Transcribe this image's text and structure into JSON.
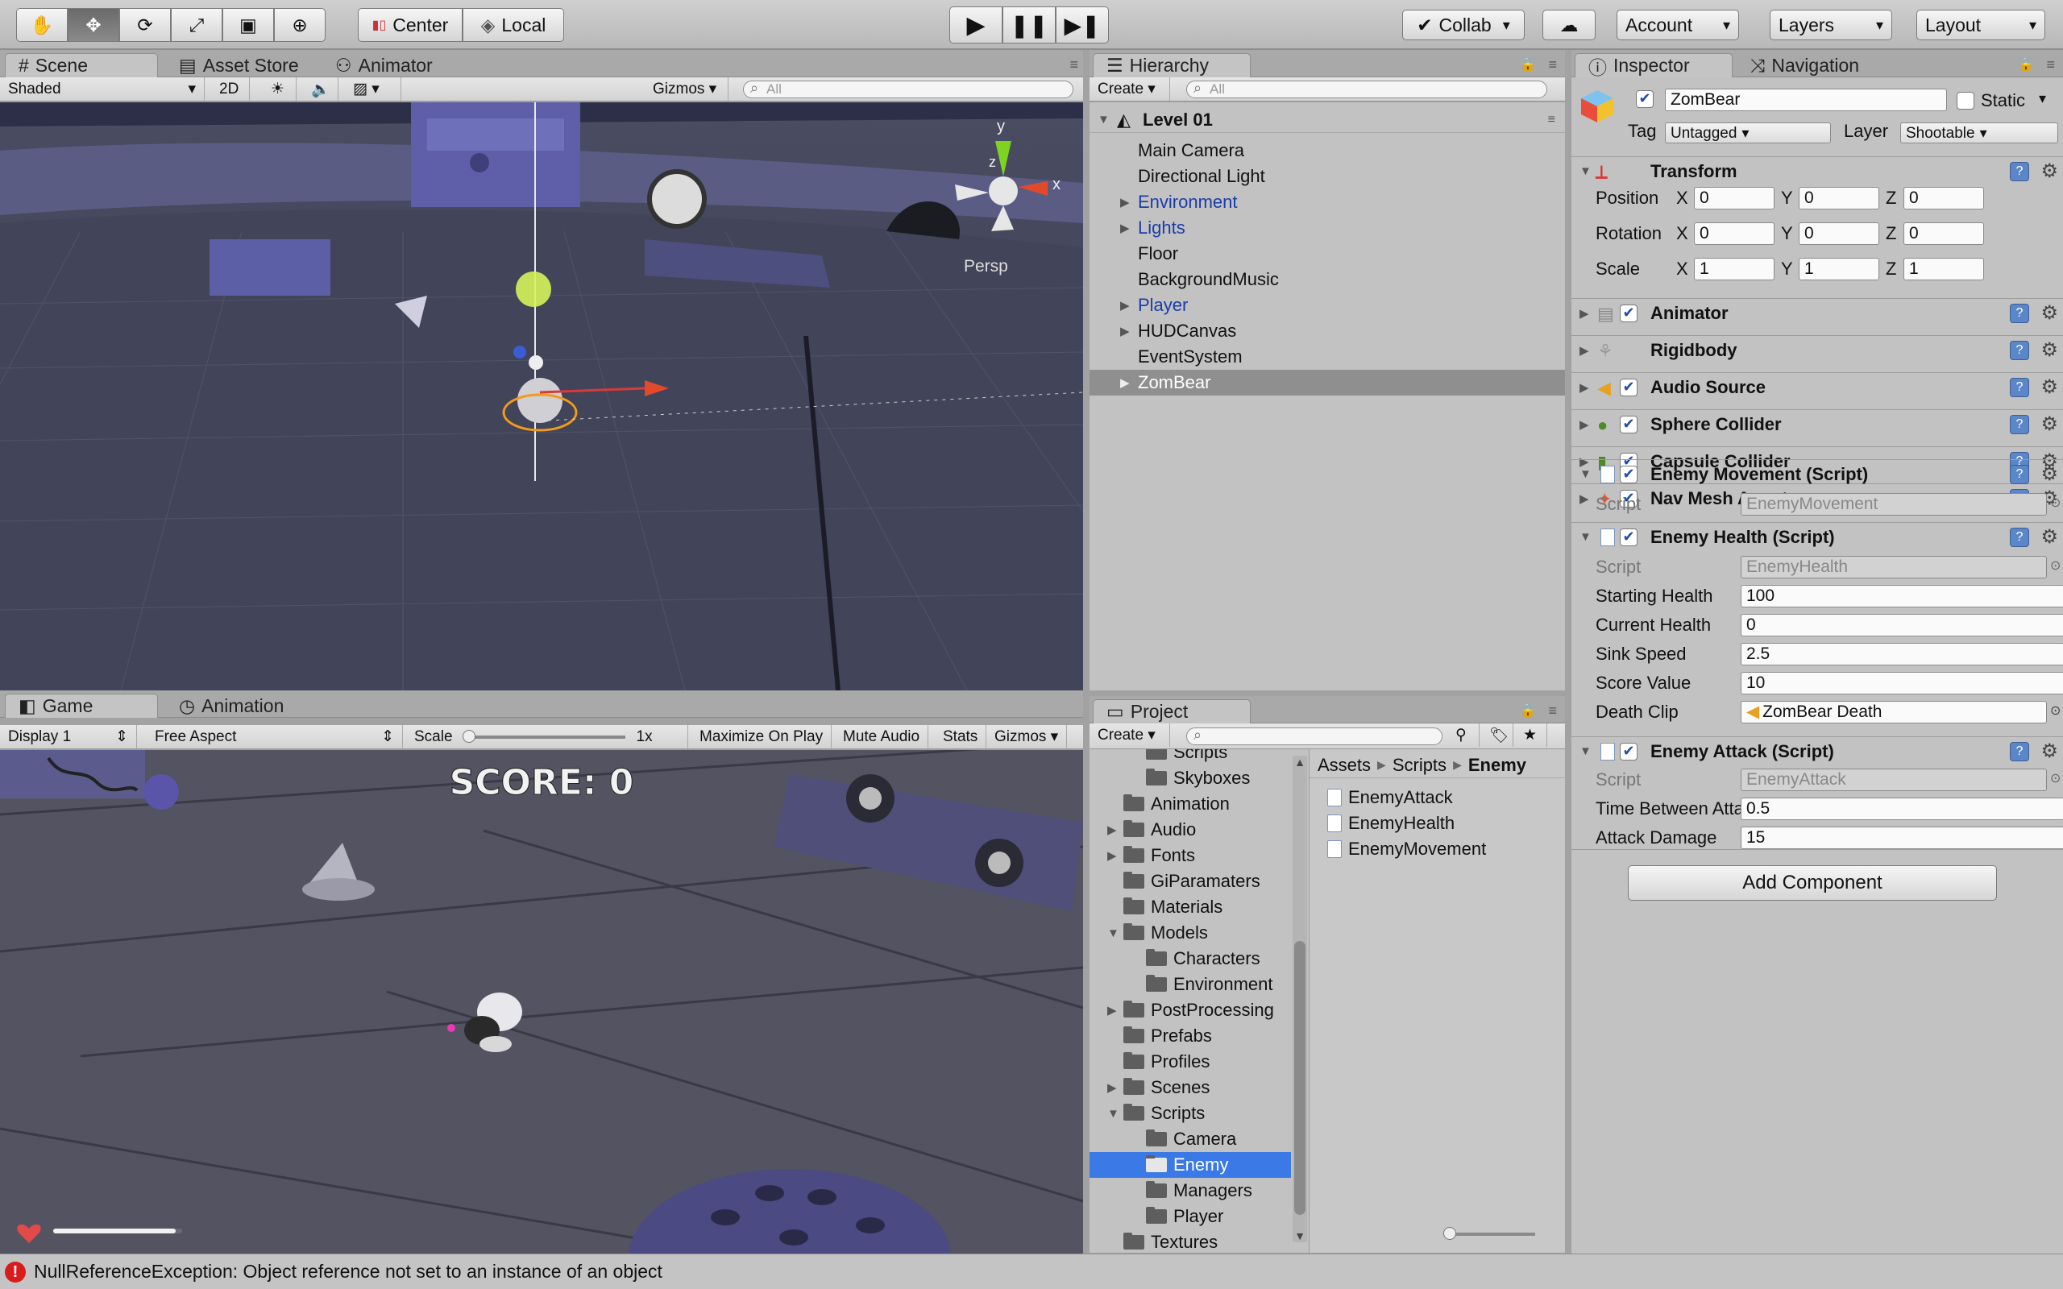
{
  "toolbar": {
    "transform_tools": [
      "hand-tool",
      "move-tool",
      "rotate-tool",
      "scale-tool",
      "rect-tool",
      "transform-tool"
    ],
    "pivot_label": "Center",
    "space_label": "Local",
    "collab_label": "Collab",
    "account_label": "Account",
    "layers_label": "Layers",
    "layout_label": "Layout"
  },
  "scene_panel": {
    "tabs": [
      "Scene",
      "Asset Store",
      "Animator"
    ],
    "shading": "Shaded",
    "mode_2d": "2D",
    "gizmos_label": "Gizmos",
    "search_placeholder": "All",
    "persp_label": "Persp",
    "axis_labels": {
      "y": "y",
      "x": "x",
      "z": "z"
    }
  },
  "game_panel": {
    "tabs": [
      "Game",
      "Animation"
    ],
    "display": "Display 1",
    "aspect": "Free Aspect",
    "scale_label": "Scale",
    "scale_value": "1x",
    "options": [
      "Maximize On Play",
      "Mute Audio",
      "Stats",
      "Gizmos"
    ],
    "score_text": "SCORE: 0",
    "health_fill": 0.95
  },
  "hierarchy": {
    "tab": "Hierarchy",
    "create_label": "Create",
    "search_placeholder": "All",
    "scene_name": "Level 01",
    "items": [
      {
        "label": "Main Camera",
        "expandable": false,
        "prefab": false,
        "selected": false
      },
      {
        "label": "Directional Light",
        "expandable": false,
        "prefab": false,
        "selected": false
      },
      {
        "label": "Environment",
        "expandable": true,
        "prefab": true,
        "selected": false
      },
      {
        "label": "Lights",
        "expandable": true,
        "prefab": true,
        "selected": false
      },
      {
        "label": "Floor",
        "expandable": false,
        "prefab": false,
        "selected": false
      },
      {
        "label": "BackgroundMusic",
        "expandable": false,
        "prefab": false,
        "selected": false
      },
      {
        "label": "Player",
        "expandable": true,
        "prefab": true,
        "selected": false
      },
      {
        "label": "HUDCanvas",
        "expandable": true,
        "prefab": false,
        "selected": false
      },
      {
        "label": "EventSystem",
        "expandable": false,
        "prefab": false,
        "selected": false
      },
      {
        "label": "ZomBear",
        "expandable": true,
        "prefab": false,
        "selected": true
      }
    ]
  },
  "project": {
    "tab": "Project",
    "create_label": "Create",
    "breadcrumb": [
      "Assets",
      "Scripts",
      "Enemy"
    ],
    "folders": [
      {
        "label": "Scripts",
        "indent": 1,
        "expanded": null,
        "selected": false,
        "partial": true
      },
      {
        "label": "Skyboxes",
        "indent": 1,
        "expanded": null,
        "selected": false
      },
      {
        "label": "Animation",
        "indent": 0,
        "expanded": null,
        "selected": false
      },
      {
        "label": "Audio",
        "indent": 0,
        "expanded": false,
        "selected": false
      },
      {
        "label": "Fonts",
        "indent": 0,
        "expanded": false,
        "selected": false
      },
      {
        "label": "GiParamaters",
        "indent": 0,
        "expanded": null,
        "selected": false
      },
      {
        "label": "Materials",
        "indent": 0,
        "expanded": null,
        "selected": false
      },
      {
        "label": "Models",
        "indent": 0,
        "expanded": true,
        "selected": false
      },
      {
        "label": "Characters",
        "indent": 1,
        "expanded": null,
        "selected": false
      },
      {
        "label": "Environment",
        "indent": 1,
        "expanded": null,
        "selected": false
      },
      {
        "label": "PostProcessing",
        "indent": 0,
        "expanded": false,
        "selected": false
      },
      {
        "label": "Prefabs",
        "indent": 0,
        "expanded": null,
        "selected": false
      },
      {
        "label": "Profiles",
        "indent": 0,
        "expanded": null,
        "selected": false
      },
      {
        "label": "Scenes",
        "indent": 0,
        "expanded": false,
        "selected": false
      },
      {
        "label": "Scripts",
        "indent": 0,
        "expanded": true,
        "selected": false
      },
      {
        "label": "Camera",
        "indent": 1,
        "expanded": null,
        "selected": false
      },
      {
        "label": "Enemy",
        "indent": 1,
        "expanded": null,
        "selected": true
      },
      {
        "label": "Managers",
        "indent": 1,
        "expanded": null,
        "selected": false
      },
      {
        "label": "Player",
        "indent": 1,
        "expanded": null,
        "selected": false
      },
      {
        "label": "Textures",
        "indent": 0,
        "expanded": null,
        "selected": false
      }
    ],
    "files": [
      "EnemyAttack",
      "EnemyHealth",
      "EnemyMovement"
    ]
  },
  "inspector": {
    "tabs": [
      "Inspector",
      "Navigation"
    ],
    "object_name": "ZomBear",
    "static_label": "Static",
    "tag_label": "Tag",
    "tag_value": "Untagged",
    "layer_label": "Layer",
    "layer_value": "Shootable",
    "transform": {
      "title": "Transform",
      "rows": [
        {
          "label": "Position",
          "x": "0",
          "y": "0",
          "z": "0"
        },
        {
          "label": "Rotation",
          "x": "0",
          "y": "0",
          "z": "0"
        },
        {
          "label": "Scale",
          "x": "1",
          "y": "1",
          "z": "1"
        }
      ]
    },
    "components": [
      "Animator",
      "Rigidbody",
      "Audio Source",
      "Sphere Collider",
      "Capsule Collider",
      "Nav Mesh Agent"
    ],
    "enemy_movement": {
      "title": "Enemy Movement (Script)",
      "script_label": "Script",
      "script_value": "EnemyMovement"
    },
    "enemy_health": {
      "title": "Enemy Health (Script)",
      "script_label": "Script",
      "script_value": "EnemyHealth",
      "fields": [
        {
          "label": "Starting Health",
          "value": "100"
        },
        {
          "label": "Current Health",
          "value": "0"
        },
        {
          "label": "Sink Speed",
          "value": "2.5"
        },
        {
          "label": "Score Value",
          "value": "10"
        },
        {
          "label": "Death Clip",
          "value": "ZomBear Death"
        }
      ]
    },
    "enemy_attack": {
      "title": "Enemy Attack (Script)",
      "script_label": "Script",
      "script_value": "EnemyAttack",
      "fields": [
        {
          "label": "Time Between Attacks",
          "value": "0.5"
        },
        {
          "label": "Attack Damage",
          "value": "15"
        }
      ]
    },
    "add_component_label": "Add Component"
  },
  "status_bar": {
    "message": "NullReferenceException: Object reference not set to an instance of an object"
  },
  "colors": {
    "selection_blue": "#3b79e6",
    "prefab_blue": "#1a3ca8",
    "error_red": "#d81b1b"
  }
}
